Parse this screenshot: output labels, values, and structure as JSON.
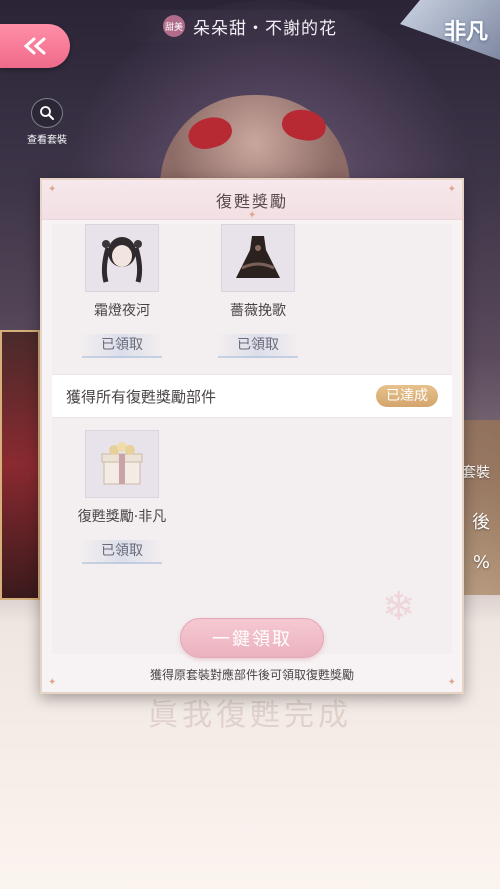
{
  "header": {
    "badge": "甜美",
    "title": "朵朵甜・不謝的花",
    "corner_banner": "非凡"
  },
  "view_outfit": {
    "label": "查看套裝"
  },
  "modal": {
    "title": "復甦獎勵",
    "items": [
      {
        "name": "霜燈夜河",
        "status": "已領取",
        "icon": "hairstyle-icon"
      },
      {
        "name": "薔薇挽歌",
        "status": "已領取",
        "icon": "dress-icon"
      }
    ],
    "section": {
      "label": "獲得所有復甦獎勵部件",
      "status": "已達成"
    },
    "reward_item": {
      "name": "復甦獎勵·非凡",
      "status": "已領取",
      "icon": "gift-box-icon"
    },
    "claim_all_label": "一鍵領取",
    "footer_note": "獲得原套裝對應部件後可領取復甦獎勵"
  },
  "background": {
    "right_text_a": "套裝",
    "right_text_b": "後",
    "right_text_c": "%",
    "bottom_title": "眞我復甦完成"
  },
  "colors": {
    "accent_pink": "#f06a8a",
    "achieved_gold": "#d3a56c",
    "modal_bg": "#f7f3f4"
  }
}
